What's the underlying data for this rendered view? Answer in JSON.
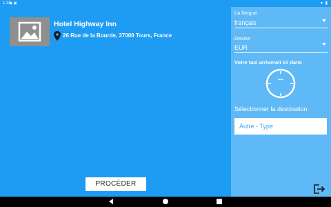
{
  "statusbar": {
    "time": "1:28",
    "icons": "◉ ▣",
    "right_icons": "▾ ▮"
  },
  "hotel": {
    "image_icon": "image-placeholder-icon",
    "name": "Hotel Highway Inn",
    "pin_icon": "location-pin-icon",
    "address": "26 Rue de la Bourde, 37000 Tours, France"
  },
  "actions": {
    "proceed_label": "PROCÉDER"
  },
  "panel": {
    "language_label": "La langue",
    "language_value": "français",
    "currency_label": "Devise",
    "currency_value": "EUR",
    "taxi_label": "Votre taxi arriverait ici dans",
    "clock_icon": "clock-icon",
    "destination_label": "Sélectionner la destination",
    "destination_value": "Autre - Type",
    "exit_icon": "exit-icon"
  },
  "colors": {
    "background": "#1e9bf2",
    "panel": "#5fb9f6",
    "placeholder_image": "#8f8f8f",
    "input_text": "#3ea6f3"
  }
}
